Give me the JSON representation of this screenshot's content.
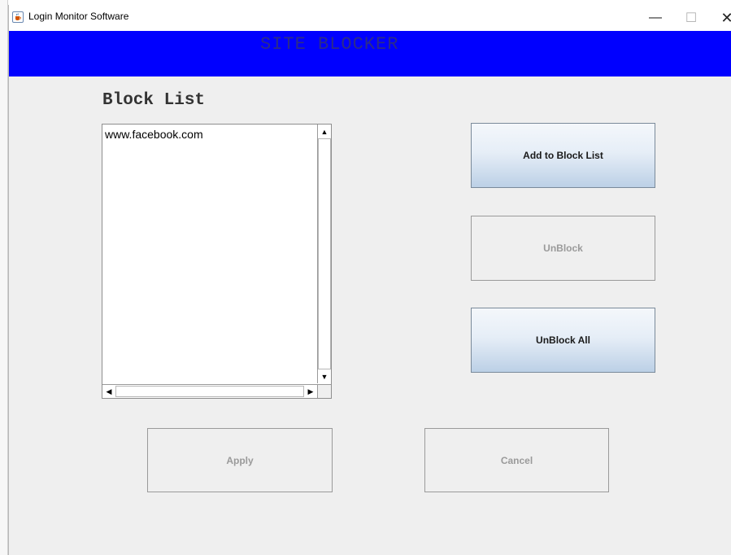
{
  "window": {
    "title": "Login Monitor Software",
    "minimize_glyph": "—",
    "maximize_glyph": "☐",
    "close_glyph": "✕"
  },
  "banner": {
    "title": "SITE BLOCKER",
    "background_color": "#0000ff"
  },
  "block_list": {
    "label": "Block List",
    "items": [
      "www.facebook.com"
    ]
  },
  "buttons": {
    "add": "Add to Block List",
    "unblock": "UnBlock",
    "unblock_all": "UnBlock All",
    "apply": "Apply",
    "cancel": "Cancel"
  },
  "icons": {
    "app": "java-cup-icon",
    "scroll_up": "scroll-up-arrow-icon",
    "scroll_down": "scroll-down-arrow-icon",
    "scroll_left": "scroll-left-arrow-icon",
    "scroll_right": "scroll-right-arrow-icon"
  },
  "state": {
    "unblock_enabled": false,
    "apply_enabled": false,
    "cancel_enabled": false
  }
}
